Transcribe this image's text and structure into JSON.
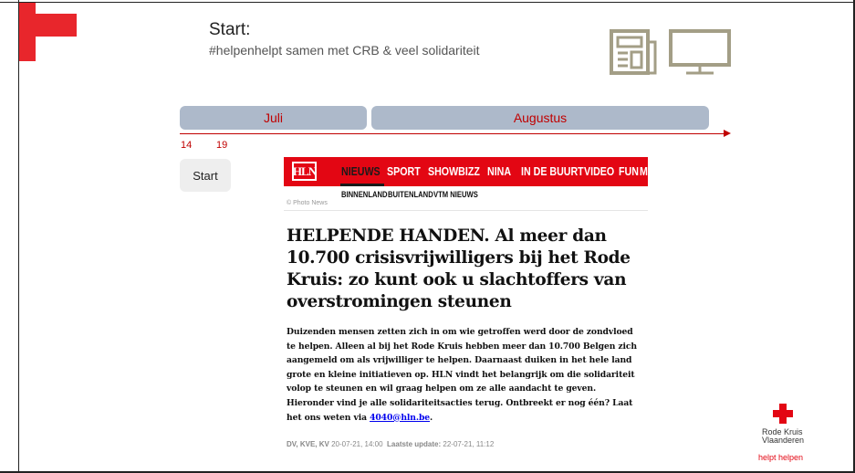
{
  "slide": {
    "title": "Start:",
    "subtitle": "#helpenhelpt samen met CRB & veel solidariteit",
    "icons": [
      "newspaper-icon",
      "tv-monitor-icon"
    ],
    "accent_color": "#e8262c",
    "icon_color": "#a39e86"
  },
  "timeline": {
    "months": [
      {
        "label": "Juli"
      },
      {
        "label": "Augustus"
      }
    ],
    "days": [
      "14",
      "19"
    ],
    "color": "#c00000",
    "start_button": "Start"
  },
  "article": {
    "logo": "HLN",
    "nav": [
      "NIEUWS",
      "SPORT",
      "SHOWBIZZ",
      "NINA",
      "IN DE BUURT",
      "VIDEO",
      "FUN",
      "M"
    ],
    "active_nav": "NIEUWS",
    "subnav": [
      "BINNENLAND",
      "BUITENLAND",
      "VTM NIEUWS"
    ],
    "photo_credit": "© Photo News",
    "headline": "HELPENDE HANDEN. Al meer dan 10.700 crisisvrijwilligers bij het Rode Kruis: zo kunt ook u slachtoffers van overstromingen steunen",
    "body": "Duizenden mensen zetten zich in om wie getroffen werd door de zondvloed te helpen. Alleen al bij het Rode Kruis hebben meer dan 10.700 Belgen zich aangemeld om als vrijwilliger te helpen. Daarnaast duiken in het hele land grote en kleine initiatieven op. HLN vindt het belangrijk om die solidariteit volop te steunen en wil graag helpen om ze alle aandacht te geven. Hieronder vind je alle solidariteitsacties terug. Ontbreekt er nog één? Laat het ons weten via",
    "email": "4040@hln.be",
    "body_end": ".",
    "authors": "DV, KVE, KV",
    "date": "20-07-21, 14:00",
    "update_label": "Laatste update:",
    "update_date": "22-07-21, 11:12",
    "brand_color": "#e30613"
  },
  "brand": {
    "name_line1": "Rode Kruis",
    "name_line2": "Vlaanderen",
    "slogan": "helpt helpen"
  }
}
